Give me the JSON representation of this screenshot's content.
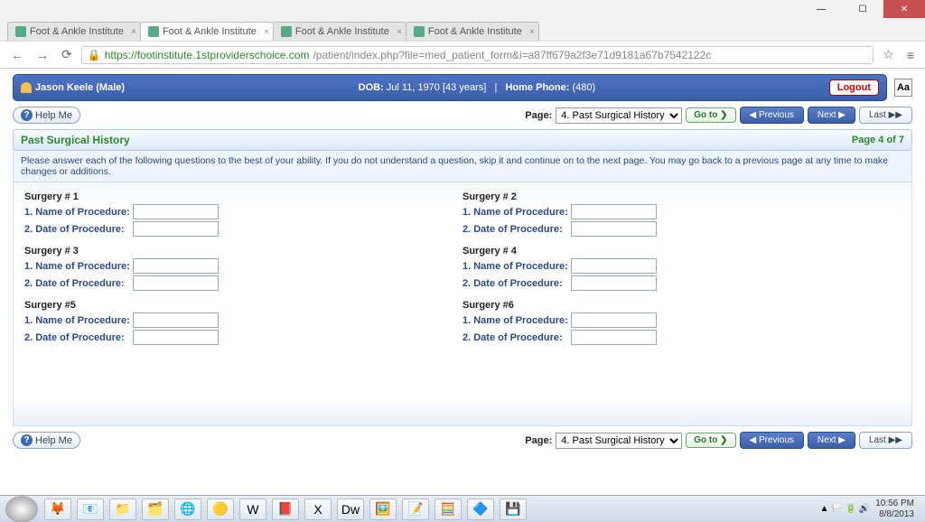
{
  "tabs": [
    {
      "title": "Foot & Ankle Institute"
    },
    {
      "title": "Foot & Ankle Institute"
    },
    {
      "title": "Foot & Ankle Institute"
    },
    {
      "title": "Foot & Ankle Institute"
    }
  ],
  "url": {
    "green": "https://footinstitute.1stproviderschoice.com",
    "gray": "/patient/index.php?file=med_patient_form&i=a87ff679a2f3e71d9181a67b7542122c"
  },
  "patient": {
    "name": "Jason Keele  (Male)",
    "dob_label": "DOB:",
    "dob": "Jul 11, 1970  [43 years]",
    "sep": "|",
    "phone_label": "Home Phone:",
    "phone": "(480)"
  },
  "logout": "Logout",
  "aa": "Aa",
  "help": "Help Me",
  "page_label": "Page:",
  "page_select": "4. Past Surgical History",
  "go": "Go to ❯",
  "prev": "◀ Previous",
  "next": "Next ▶",
  "last": "Last ▶▶",
  "title": "Past Surgical History",
  "pagenum": "Page 4 of 7",
  "instructions": "Please answer each of the following questions to the best of your ability. If you do not understand a question, skip it and continue on to the next page. You may go back to a previous page at any time to make changes or additions.",
  "q_name": "1. Name of Procedure:",
  "q_date": "2. Date of Procedure:",
  "surgeries": [
    "Surgery # 1",
    "Surgery # 2",
    "Surgery # 3",
    "Surgery # 4",
    "Surgery #5",
    "Surgery #6"
  ],
  "clock": {
    "time": "10:56 PM",
    "date": "8/8/2013"
  }
}
